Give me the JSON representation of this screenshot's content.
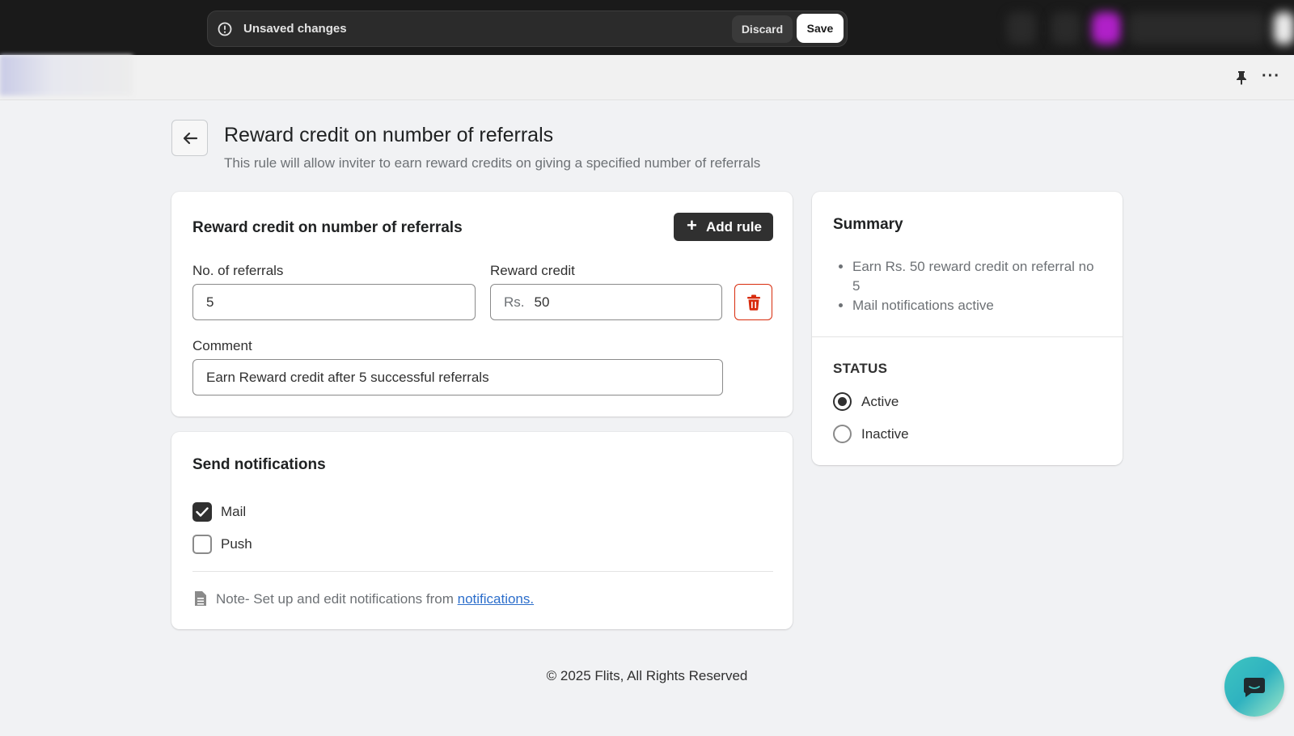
{
  "topbar": {
    "unsaved_label": "Unsaved changes",
    "discard_label": "Discard",
    "save_label": "Save"
  },
  "page": {
    "title": "Reward credit on number of referrals",
    "subtitle": "This rule will allow inviter to earn reward credits on giving a specified number of referrals"
  },
  "rule_card": {
    "title": "Reward credit on number of referrals",
    "add_rule_label": "Add rule",
    "referrals_label": "No. of referrals",
    "referrals_value": "5",
    "reward_label": "Reward credit",
    "reward_prefix": "Rs.",
    "reward_value": "50",
    "comment_label": "Comment",
    "comment_value": "Earn Reward credit after 5 successful referrals"
  },
  "notifications_card": {
    "title": "Send notifications",
    "mail_label": "Mail",
    "mail_checked": true,
    "push_label": "Push",
    "push_checked": false,
    "note_text": "Note- Set up and edit notifications from ",
    "note_link": "notifications."
  },
  "summary_card": {
    "title": "Summary",
    "items": [
      "Earn Rs. 50 reward credit on referral no 5",
      "Mail notifications active"
    ],
    "status_title": "STATUS",
    "status_options": [
      "Active",
      "Inactive"
    ],
    "status_selected": "Active"
  },
  "footer": {
    "copyright": "© 2025 Flits, All Rights Reserved"
  },
  "colors": {
    "topbar_bg": "#1a1a1a",
    "primary_button": "#303030",
    "danger": "#d82c0d",
    "link": "#2c6ecb",
    "page_bg": "#f1f2f4",
    "chat_accent": "#3ec5c1"
  }
}
